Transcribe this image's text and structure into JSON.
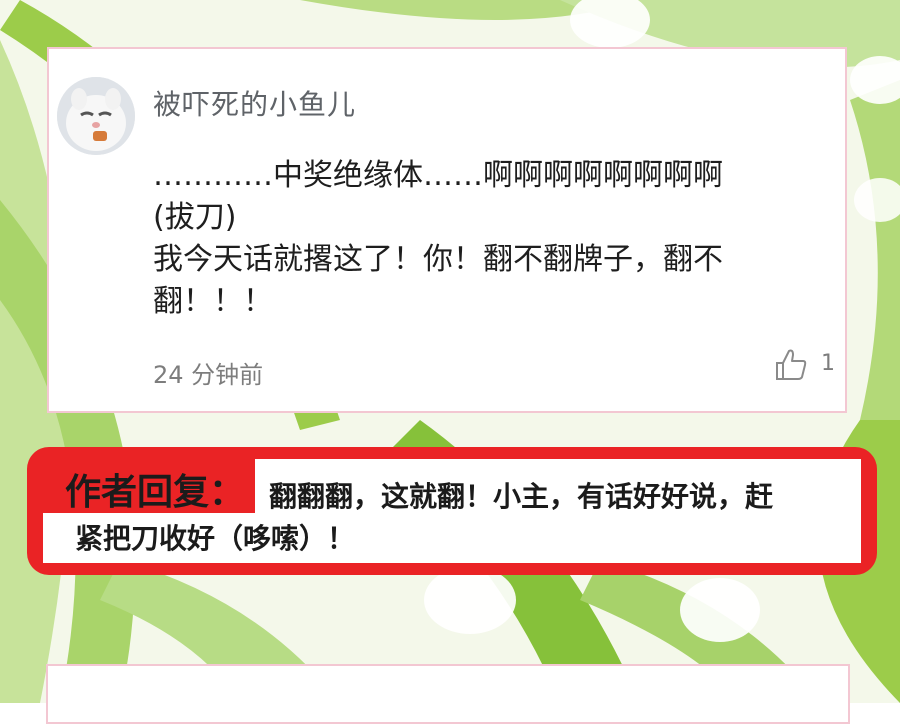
{
  "colors": {
    "card_border": "#f3c7d2",
    "reply_red": "#ea2325",
    "leaf_green": "#9ccc4a",
    "username_gray": "#5f6368"
  },
  "comment": {
    "avatar_icon": "cat-avatar-icon",
    "username": "被吓死的小鱼儿",
    "text_lines": [
      "…………中奖绝缘体……啊啊啊啊啊啊啊啊",
      "(拔刀)",
      "我今天话就撂这了！你！翻不翻牌子，翻不",
      "翻！！！"
    ],
    "time": "24 分钟前",
    "like_icon": "thumbs-up-icon",
    "like_count": "1"
  },
  "author_reply": {
    "label": "作者回复：",
    "line1": "翻翻翻，这就翻！小主，有话好好说，赶",
    "line2": "紧把刀收好（哆嗦）！"
  }
}
